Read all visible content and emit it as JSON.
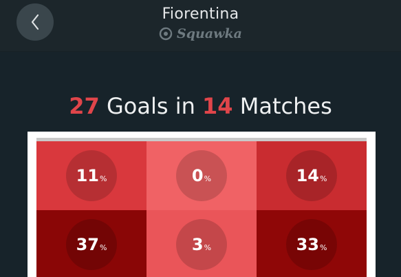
{
  "header": {
    "title": "Fiorentina",
    "brand": "Squawka",
    "back_icon": "chevron-left-icon",
    "brand_icon": "squawka-logo-icon"
  },
  "headline": {
    "goals": "27",
    "goals_label": "Goals in",
    "matches": "14",
    "matches_label": "Matches"
  },
  "zones": [
    {
      "value": "11",
      "unit": "%",
      "color": "#d9383d"
    },
    {
      "value": "0",
      "unit": "%",
      "color": "#f06265"
    },
    {
      "value": "14",
      "unit": "%",
      "color": "#c92c30"
    },
    {
      "value": "37",
      "unit": "%",
      "color": "#8a0606"
    },
    {
      "value": "3",
      "unit": "%",
      "color": "#ea5559"
    },
    {
      "value": "33",
      "unit": "%",
      "color": "#8f0707"
    }
  ],
  "colors": {
    "accent": "#e0454a",
    "background": "#1c262b"
  }
}
